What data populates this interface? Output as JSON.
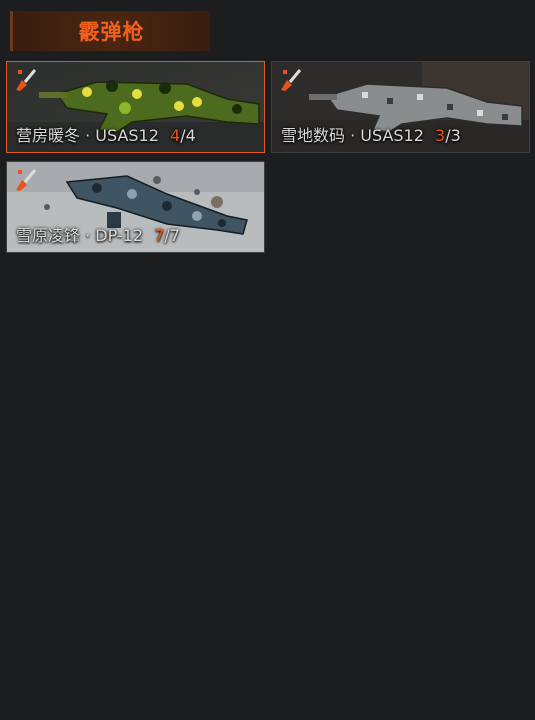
{
  "category": {
    "title": "霰弹枪"
  },
  "skins": [
    {
      "name": "营房暖冬",
      "weapon": "USAS12",
      "current": "4",
      "total": "4",
      "selected": true
    },
    {
      "name": "雪地数码",
      "weapon": "USAS12",
      "current": "3",
      "total": "3",
      "selected": false
    },
    {
      "name": "雪原凌锋",
      "weapon": "DP-12",
      "current": "7",
      "total": "7",
      "selected": false
    }
  ],
  "colors": {
    "accent": "#e8531a",
    "header_bg": "#3a1d0e",
    "page_bg": "#1b1d1f"
  },
  "icons": {
    "paint": "paint-brush-icon"
  }
}
